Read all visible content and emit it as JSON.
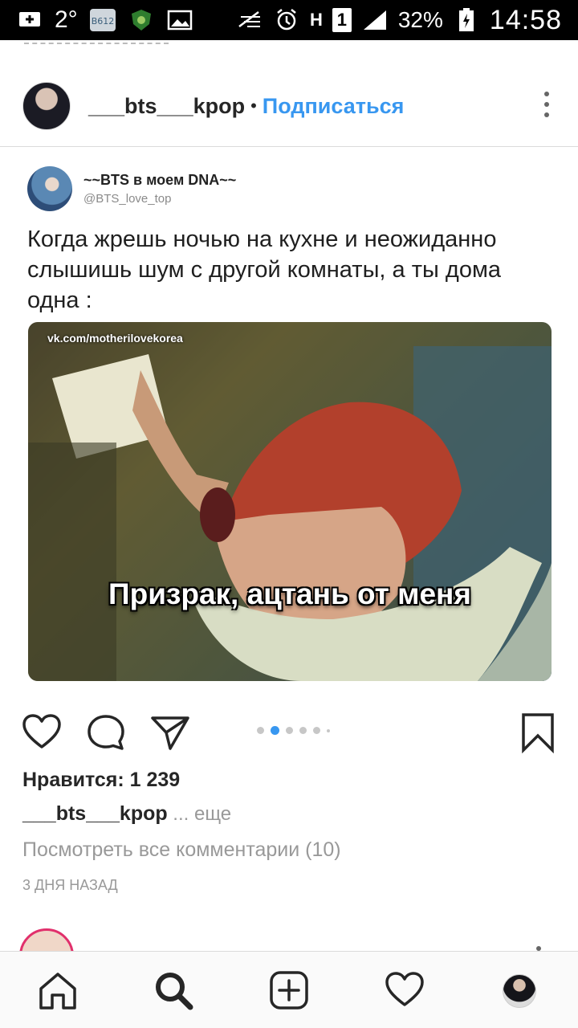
{
  "status_bar": {
    "notification_count": "2°",
    "battery_percent": "32%",
    "time": "14:58",
    "sim_label": "1",
    "network_label": "H"
  },
  "post": {
    "username": "___bts___kpop",
    "separator": "•",
    "follow_label": "Подписаться",
    "tweet": {
      "name": "~~BTS в моем DNA~~",
      "handle": "@BTS_love_top",
      "text": "Когда жрешь ночью на кухне и неожиданно слышишь шум с другой комнаты, а ты дома одна :"
    },
    "meme": {
      "watermark": "vk.com/motherilovekorea",
      "caption": "Призрак, ацтань от меня"
    },
    "carousel": {
      "count": 6,
      "active_index": 1
    },
    "likes_text": "Нравится: 1 239",
    "caption_user": "___bts___kpop",
    "caption_more": " ... еще",
    "comments_text": "Посмотреть все комментарии (10)",
    "time_ago": "3 ДНЯ НАЗАД"
  },
  "icons": {
    "like": "heart-icon",
    "comment": "speech-bubble-icon",
    "share": "paper-plane-icon",
    "save": "bookmark-icon",
    "nav_home": "home-icon",
    "nav_search": "search-icon",
    "nav_add": "plus-square-icon",
    "nav_activity": "heart-icon",
    "nav_profile": "profile-avatar"
  },
  "colors": {
    "link_blue": "#3897f0",
    "carousel_active": "#3897f0",
    "text_primary": "#262626",
    "text_secondary": "#999999"
  }
}
